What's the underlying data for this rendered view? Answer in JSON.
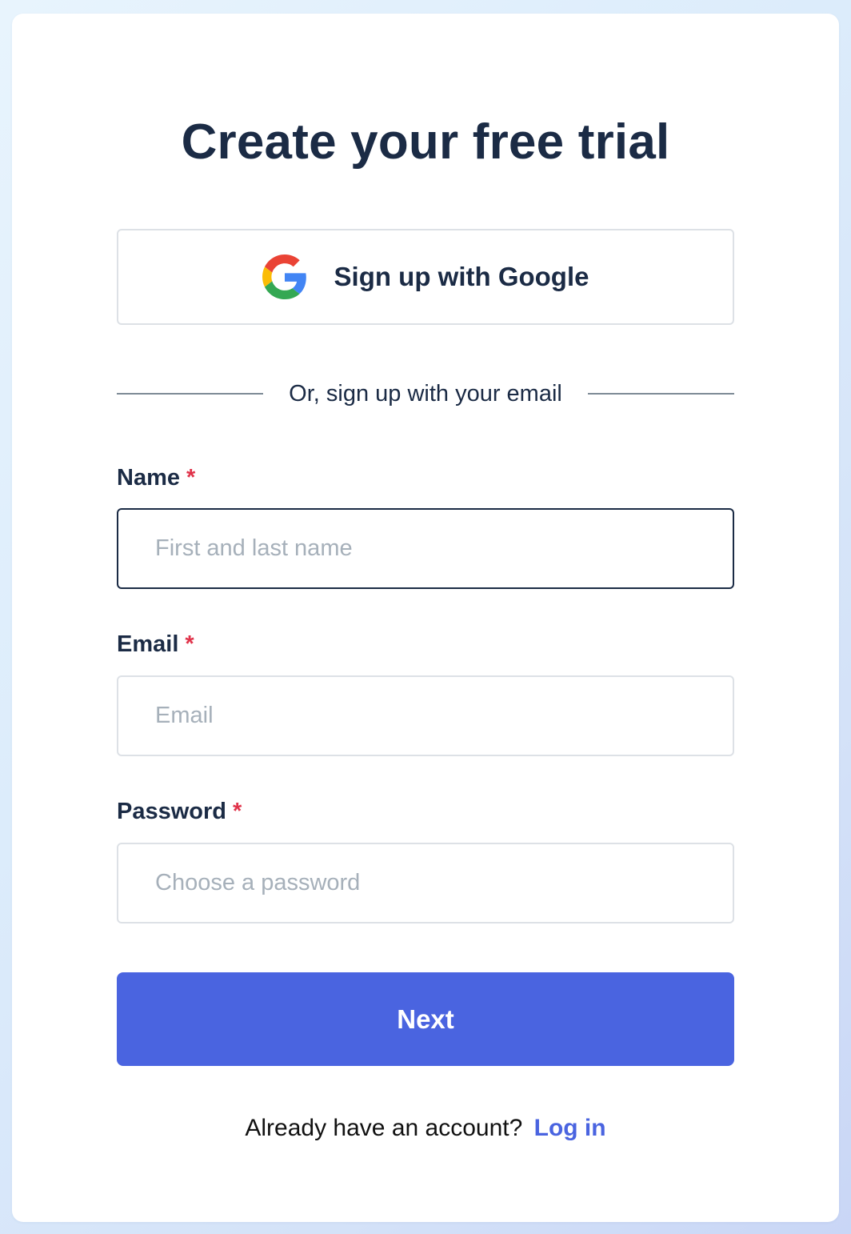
{
  "page": {
    "title": "Create your free trial"
  },
  "google": {
    "label": "Sign up with Google",
    "icon": "google-logo"
  },
  "divider": {
    "text": "Or, sign up with your email"
  },
  "fields": {
    "name": {
      "label": "Name",
      "required_mark": "*",
      "placeholder": "First and last name",
      "value": ""
    },
    "email": {
      "label": "Email",
      "required_mark": "*",
      "placeholder": "Email",
      "value": ""
    },
    "password": {
      "label": "Password",
      "required_mark": "*",
      "placeholder": "Choose a password",
      "value": ""
    }
  },
  "submit": {
    "label": "Next"
  },
  "footer": {
    "prompt": "Already have an account?",
    "link_label": "Log in"
  },
  "colors": {
    "primary": "#4a64e0",
    "heading": "#1b2b45",
    "required": "#e0334a",
    "placeholder": "#a6b0ba",
    "border": "#dde1e6"
  }
}
